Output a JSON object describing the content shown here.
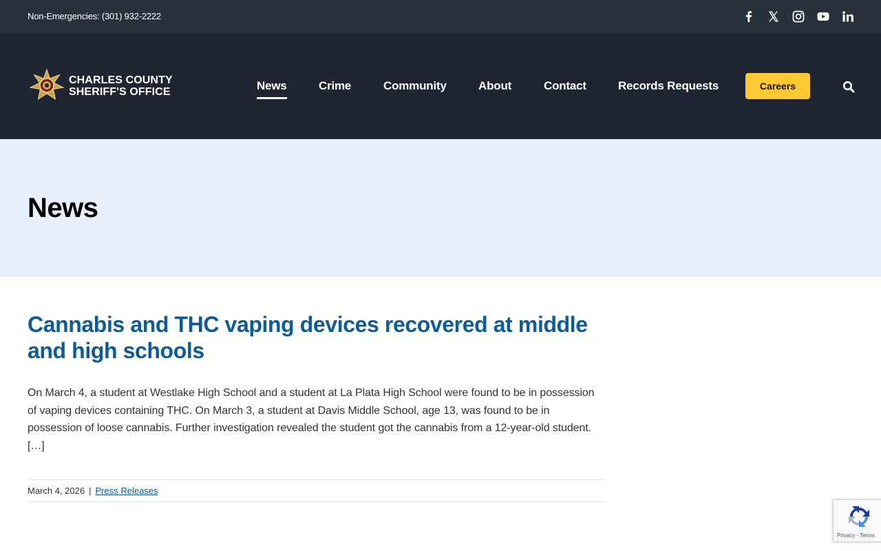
{
  "topbar": {
    "phone": "Non-Emergencies: (301) 932-2222",
    "social": [
      "facebook-icon",
      "x-icon",
      "instagram-icon",
      "youtube-icon",
      "linkedin-icon"
    ]
  },
  "header": {
    "logo_line1": "CHARLES COUNTY",
    "logo_line2": "SHERIFF'S OFFICE",
    "nav": [
      {
        "label": "News",
        "active": true
      },
      {
        "label": "Crime"
      },
      {
        "label": "Community"
      },
      {
        "label": "About"
      },
      {
        "label": "Contact"
      },
      {
        "label": "Records Requests"
      }
    ],
    "careers_label": "Careers",
    "search_icon": "search-icon"
  },
  "banner": {
    "title": "News"
  },
  "article": {
    "title": "Cannabis and THC vaping devices recovered at middle and high schools",
    "excerpt": "On March 4, a student at Westlake High School and a student at La Plata High School were found to be in possession of vaping devices containing THC. On March 3, a student at Davis Middle School, age 13, was found to be in possession of loose cannabis. Further investigation revealed the student got the cannabis from a 12-year-old student. […]",
    "date": "March 4, 2026",
    "separator": "|",
    "category": "Press Releases"
  },
  "recaptcha": {
    "terms": "Privacy - Terms"
  },
  "colors": {
    "topbar_bg": "#29313c",
    "header_bg": "#1f2631",
    "banner_bg": "#e8f0fd",
    "title_blue": "#0b5c97",
    "careers_yellow": "#fdc933"
  }
}
